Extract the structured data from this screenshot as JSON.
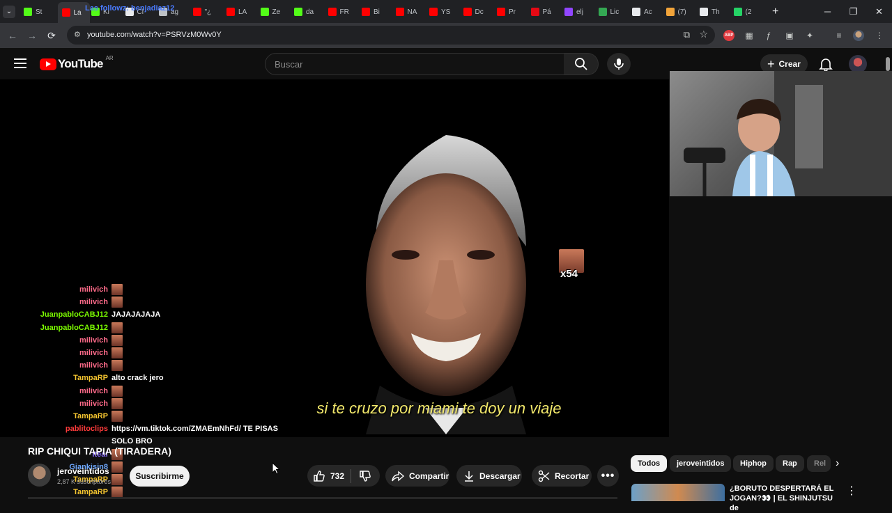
{
  "browser": {
    "tabs": [
      {
        "label": "St",
        "icon": "kick-icon",
        "color": "#53fc18"
      },
      {
        "label": "La",
        "icon": "youtube-icon",
        "color": "#ff0000",
        "active": true
      },
      {
        "label": "Ki",
        "icon": "kick-icon",
        "color": "#53fc18"
      },
      {
        "label": "Cl",
        "icon": "x-icon",
        "color": "#e8eaed"
      },
      {
        "label": "ag",
        "icon": "globe-icon",
        "color": "#bdc1c6"
      },
      {
        "label": "\"¿",
        "icon": "youtube-icon",
        "color": "#ff0000"
      },
      {
        "label": "LA",
        "icon": "youtube-icon",
        "color": "#ff0000"
      },
      {
        "label": "Ze",
        "icon": "kick-icon",
        "color": "#53fc18"
      },
      {
        "label": "da",
        "icon": "kick-icon",
        "color": "#53fc18"
      },
      {
        "label": "FR",
        "icon": "youtube-icon",
        "color": "#ff0000"
      },
      {
        "label": "Bi",
        "icon": "youtube-icon",
        "color": "#ff0000"
      },
      {
        "label": "NA",
        "icon": "youtube-icon",
        "color": "#ff0000"
      },
      {
        "label": "YS",
        "icon": "youtube-icon",
        "color": "#ff0000"
      },
      {
        "label": "Dc",
        "icon": "youtube-icon",
        "color": "#ff0000"
      },
      {
        "label": "Pr",
        "icon": "youtube-icon",
        "color": "#ff0000"
      },
      {
        "label": "Pá",
        "icon": "netflix-icon",
        "color": "#e50914"
      },
      {
        "label": "elj",
        "icon": "twitch-icon",
        "color": "#9146ff"
      },
      {
        "label": "Lic",
        "icon": "globe-icon",
        "color": "#34a853"
      },
      {
        "label": "Ac",
        "icon": "x-icon",
        "color": "#e8eaed"
      },
      {
        "label": "(7)",
        "icon": "app-icon",
        "color": "#f2a43a"
      },
      {
        "label": "Th",
        "icon": "diamond-icon",
        "color": "#e8eaed"
      },
      {
        "label": "(2",
        "icon": "chat-icon",
        "color": "#25d366"
      }
    ],
    "tab_overlay_text": "Las followz: benjadiaz12",
    "url": "youtube.com/watch?v=PSRVzM0Wv0Y"
  },
  "youtube": {
    "logo_word": "YouTube",
    "country": "AR",
    "search_placeholder": "Buscar",
    "create_label": "Crear"
  },
  "video": {
    "subtitle": "si te cruzo por miami te doy un viaje",
    "emote_count": "x54"
  },
  "chat": [
    {
      "user": "milivich",
      "color": "#ff6b8a",
      "msg": "",
      "emote": true
    },
    {
      "user": "milivich",
      "color": "#ff6b8a",
      "msg": "",
      "emote": true
    },
    {
      "user": "JuanpabloCABJ12",
      "color": "#7cfc00",
      "msg": "JAJAJAJAJA",
      "emote": false
    },
    {
      "user": "JuanpabloCABJ12",
      "color": "#7cfc00",
      "msg": "",
      "emote": true
    },
    {
      "user": "milivich",
      "color": "#ff6b8a",
      "msg": "",
      "emote": true
    },
    {
      "user": "milivich",
      "color": "#ff6b8a",
      "msg": "",
      "emote": true
    },
    {
      "user": "milivich",
      "color": "#ff6b8a",
      "msg": "",
      "emote": true
    },
    {
      "user": "TampaRP",
      "color": "#f4c430",
      "msg": "alto crack jero",
      "emote": false
    },
    {
      "user": "milivich",
      "color": "#ff6b8a",
      "msg": "",
      "emote": true
    },
    {
      "user": "milivich",
      "color": "#ff6b8a",
      "msg": "",
      "emote": true
    },
    {
      "user": "TampaRP",
      "color": "#f4c430",
      "msg": "",
      "emote": true
    },
    {
      "user": "pablitoclips",
      "color": "#ff3b3b",
      "msg": "https://vm.tiktok.com/ZMAEmNhFd/ TE PISAS",
      "emote": false
    },
    {
      "user": "",
      "color": "#ffffff",
      "msg": "SOLO BRO",
      "emote": false
    },
    {
      "user": "Iteaf",
      "color": "#8a6cff",
      "msg": "",
      "emote": true
    },
    {
      "user": "Giankisin8",
      "color": "#6ea8ff",
      "msg": "",
      "emote": true
    },
    {
      "user": "TampaRP",
      "color": "#f4c430",
      "msg": "",
      "emote": true
    },
    {
      "user": "TampaRP",
      "color": "#f4c430",
      "msg": "",
      "emote": true
    }
  ],
  "watch": {
    "title": "RIP CHIQUI TAPIA (TIRADERA)",
    "channel": "jeroveintidos",
    "subscribers": "2,87 K suscriptores",
    "subscribe_label": "Suscribirme",
    "likes": "732",
    "share_label": "Compartir",
    "download_label": "Descargar",
    "clip_label": "Recortar"
  },
  "chips": [
    "Todos",
    "jeroveintidos",
    "Hiphop",
    "Rap",
    "Rel"
  ],
  "recommendation": {
    "title": "¿BORUTO DESPERTARÁ EL JOGAN?👀 | EL SHINJUTSU de"
  }
}
